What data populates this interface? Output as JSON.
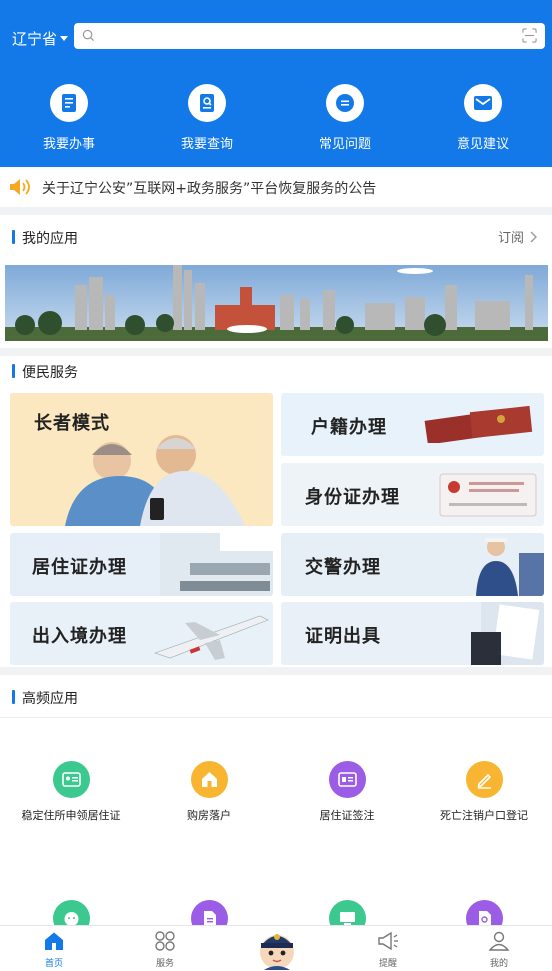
{
  "header": {
    "province": "辽宁省",
    "search_placeholder": "",
    "quick_actions": [
      {
        "label": "我要办事",
        "icon": "document-icon"
      },
      {
        "label": "我要查询",
        "icon": "query-icon"
      },
      {
        "label": "常见问题",
        "icon": "chat-icon"
      },
      {
        "label": "意见建议",
        "icon": "mail-icon"
      }
    ]
  },
  "notice": {
    "text": "关于辽宁公安”互联网+政务服务”平台恢复服务的公告"
  },
  "my_apps": {
    "title": "我的应用",
    "subscribe": "订阅"
  },
  "services": {
    "title": "便民服务",
    "tiles": [
      {
        "label": "长者模式"
      },
      {
        "label": "户籍办理"
      },
      {
        "label": "身份证办理"
      },
      {
        "label": "居住证办理"
      },
      {
        "label": "交警办理"
      },
      {
        "label": "出入境办理"
      },
      {
        "label": "证明出具"
      }
    ]
  },
  "high_freq": {
    "title": "高频应用",
    "items": [
      {
        "label": "稳定住所申领居住证",
        "color": "#3cc98f"
      },
      {
        "label": "购房落户",
        "color": "#f7b531"
      },
      {
        "label": "居住证签注",
        "color": "#9b5de5"
      },
      {
        "label": "死亡注销户口登记",
        "color": "#f7b531"
      }
    ],
    "row2_colors": [
      "#3cc98f",
      "#9b5de5",
      "#3cc98f",
      "#9b5de5"
    ]
  },
  "tabbar": {
    "tabs": [
      {
        "label": "首页",
        "active": true
      },
      {
        "label": "服务",
        "active": false
      },
      {
        "label": "提醒",
        "active": false
      },
      {
        "label": "我的",
        "active": false
      }
    ]
  },
  "colors": {
    "primary": "#1479e8"
  }
}
